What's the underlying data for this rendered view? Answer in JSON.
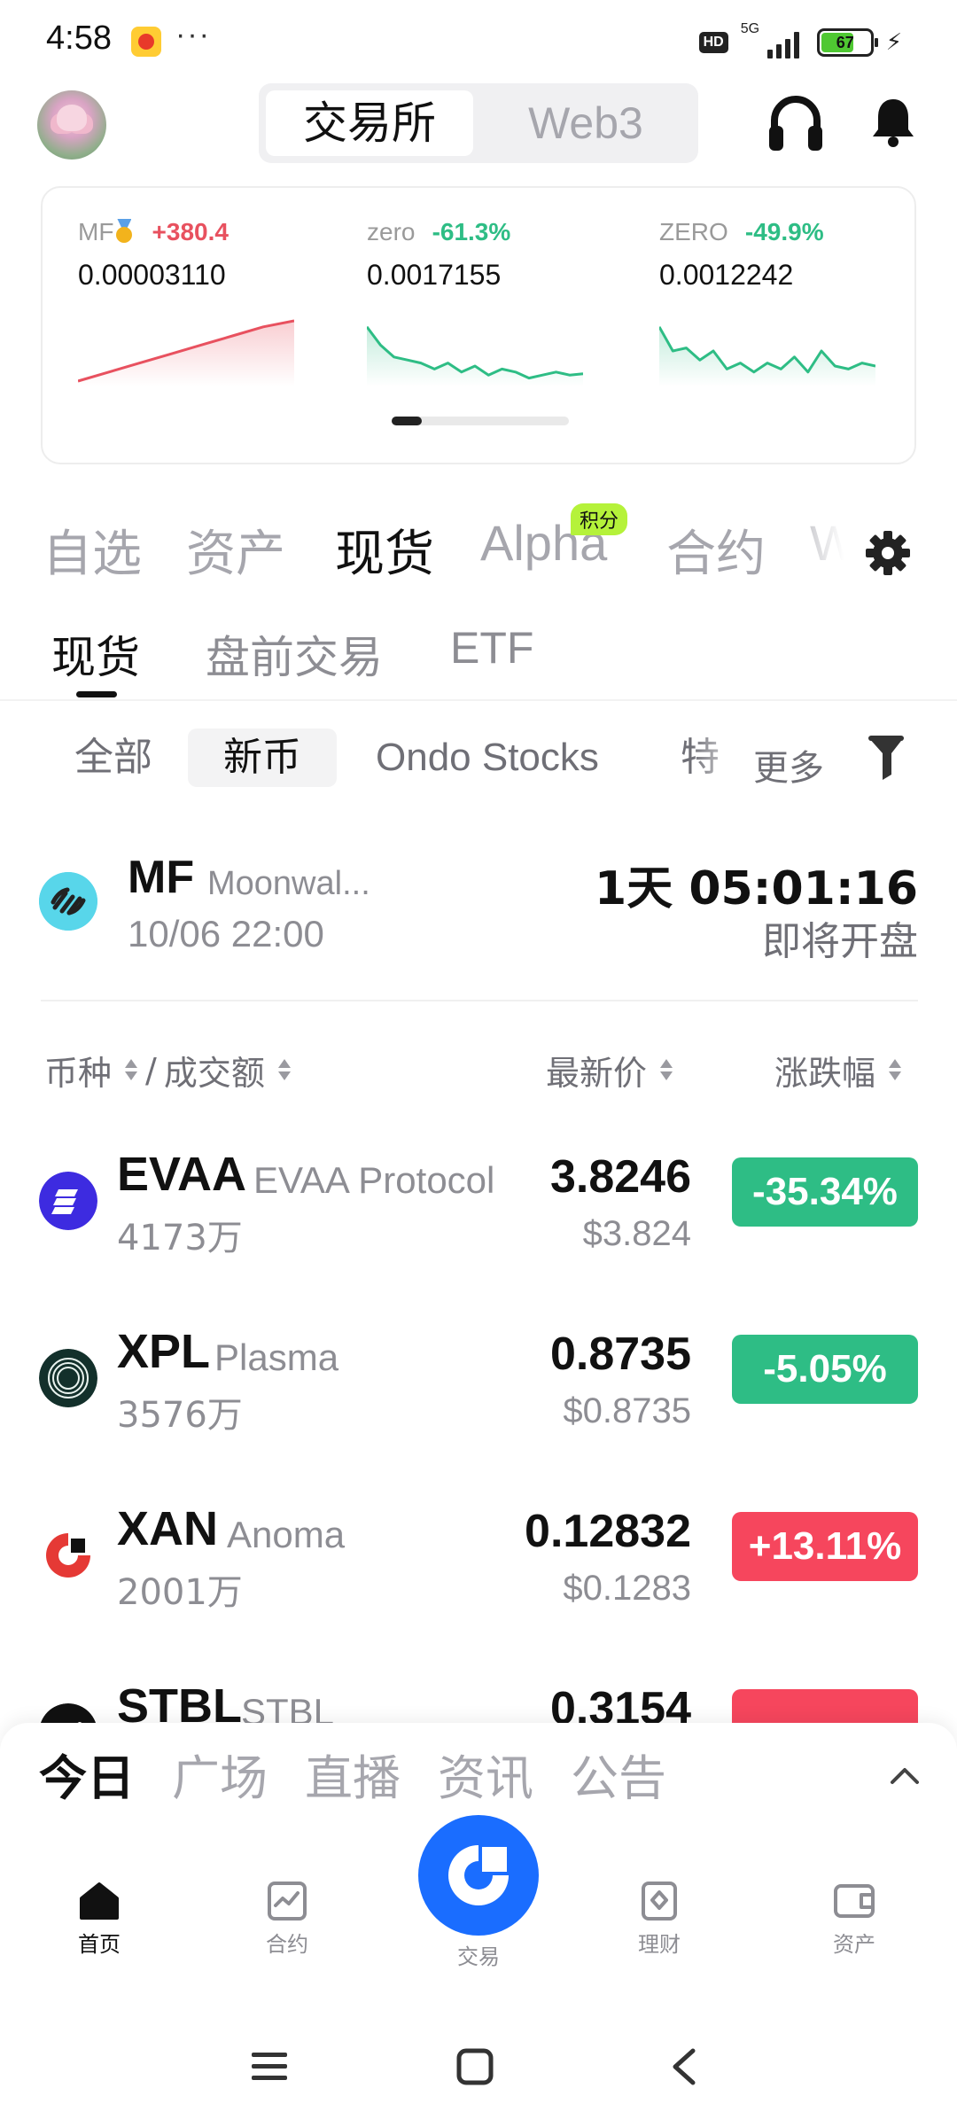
{
  "status_bar": {
    "time": "4:58",
    "dots": "···",
    "hd": "HD",
    "network": "5G",
    "battery": "67",
    "battery_level": 0.67
  },
  "header": {
    "segments": [
      "交易所",
      "Web3"
    ],
    "active_segment": "交易所"
  },
  "tickers": [
    {
      "symbol": "MF",
      "change": "+380.4",
      "price": "0.00003110",
      "color": "#e8515f",
      "spark": [
        0,
        0.15,
        0.3,
        0.45,
        0.6,
        0.75,
        0.9,
        1.0
      ]
    },
    {
      "symbol": "zero",
      "change": "-61.3%",
      "price": "0.0017155",
      "color": "#2ebd85",
      "spark": [
        0.9,
        0.6,
        0.4,
        0.35,
        0.3,
        0.2,
        0.3,
        0.15,
        0.25,
        0.1,
        0.2,
        0.15,
        0.05,
        0.1,
        0.15,
        0.1,
        0.12
      ]
    },
    {
      "symbol": "ZERO",
      "change": "-49.9%",
      "price": "0.0012242",
      "color": "#2ebd85",
      "spark": [
        0.9,
        0.5,
        0.55,
        0.35,
        0.5,
        0.2,
        0.3,
        0.15,
        0.3,
        0.2,
        0.4,
        0.15,
        0.5,
        0.25,
        0.2,
        0.3,
        0.25
      ]
    }
  ],
  "main_tabs": {
    "items": [
      "自选",
      "资产",
      "现货",
      "Alpha",
      "合约",
      "W"
    ],
    "active": "现货",
    "badge": "积分"
  },
  "sub_tabs": {
    "items": [
      "现货",
      "盘前交易",
      "ETF"
    ],
    "active": "现货"
  },
  "filters": {
    "items": [
      "全部",
      "新币",
      "Ondo Stocks",
      "特"
    ],
    "active": "新币",
    "more": "更多"
  },
  "new_listing": {
    "symbol": "MF",
    "name": "Moonwal...",
    "date": "10/06 22:00",
    "countdown": "1天 05:01:16",
    "status": "即将开盘"
  },
  "list_header": {
    "coin": "币种",
    "sep": "/",
    "volume": "成交额",
    "price": "最新价",
    "change": "涨跌幅"
  },
  "rows": [
    {
      "symbol": "EVAA",
      "name": "EVAA Protocol",
      "volume": "4173万",
      "price": "3.8246",
      "usd": "$3.824",
      "change": "-35.34%",
      "direction": "down",
      "logo_color": "#3d2be0"
    },
    {
      "symbol": "XPL",
      "name": "Plasma",
      "volume": "3576万",
      "price": "0.8735",
      "usd": "$0.8735",
      "change": "-5.05%",
      "direction": "down",
      "logo_color": "#13302b"
    },
    {
      "symbol": "XAN",
      "name": "Anoma",
      "volume": "2001万",
      "price": "0.12832",
      "usd": "$0.1283",
      "change": "+13.11%",
      "direction": "up",
      "logo_color": "#e53935"
    },
    {
      "symbol": "STBL",
      "name": "STBL",
      "volume": "",
      "price": "0.3154",
      "usd": "",
      "change": "",
      "direction": "up",
      "logo_color": "#111111"
    }
  ],
  "news_tabs": {
    "items": [
      "今日",
      "广场",
      "直播",
      "资讯",
      "公告"
    ],
    "active": "今日"
  },
  "bottom_nav": {
    "items": [
      {
        "label": "首页",
        "icon": "home-icon"
      },
      {
        "label": "合约",
        "icon": "contract-chart-icon"
      },
      {
        "label": "交易",
        "icon": "trade-icon"
      },
      {
        "label": "理财",
        "icon": "earn-icon"
      },
      {
        "label": "资产",
        "icon": "wallet-icon"
      }
    ],
    "active": "首页"
  }
}
